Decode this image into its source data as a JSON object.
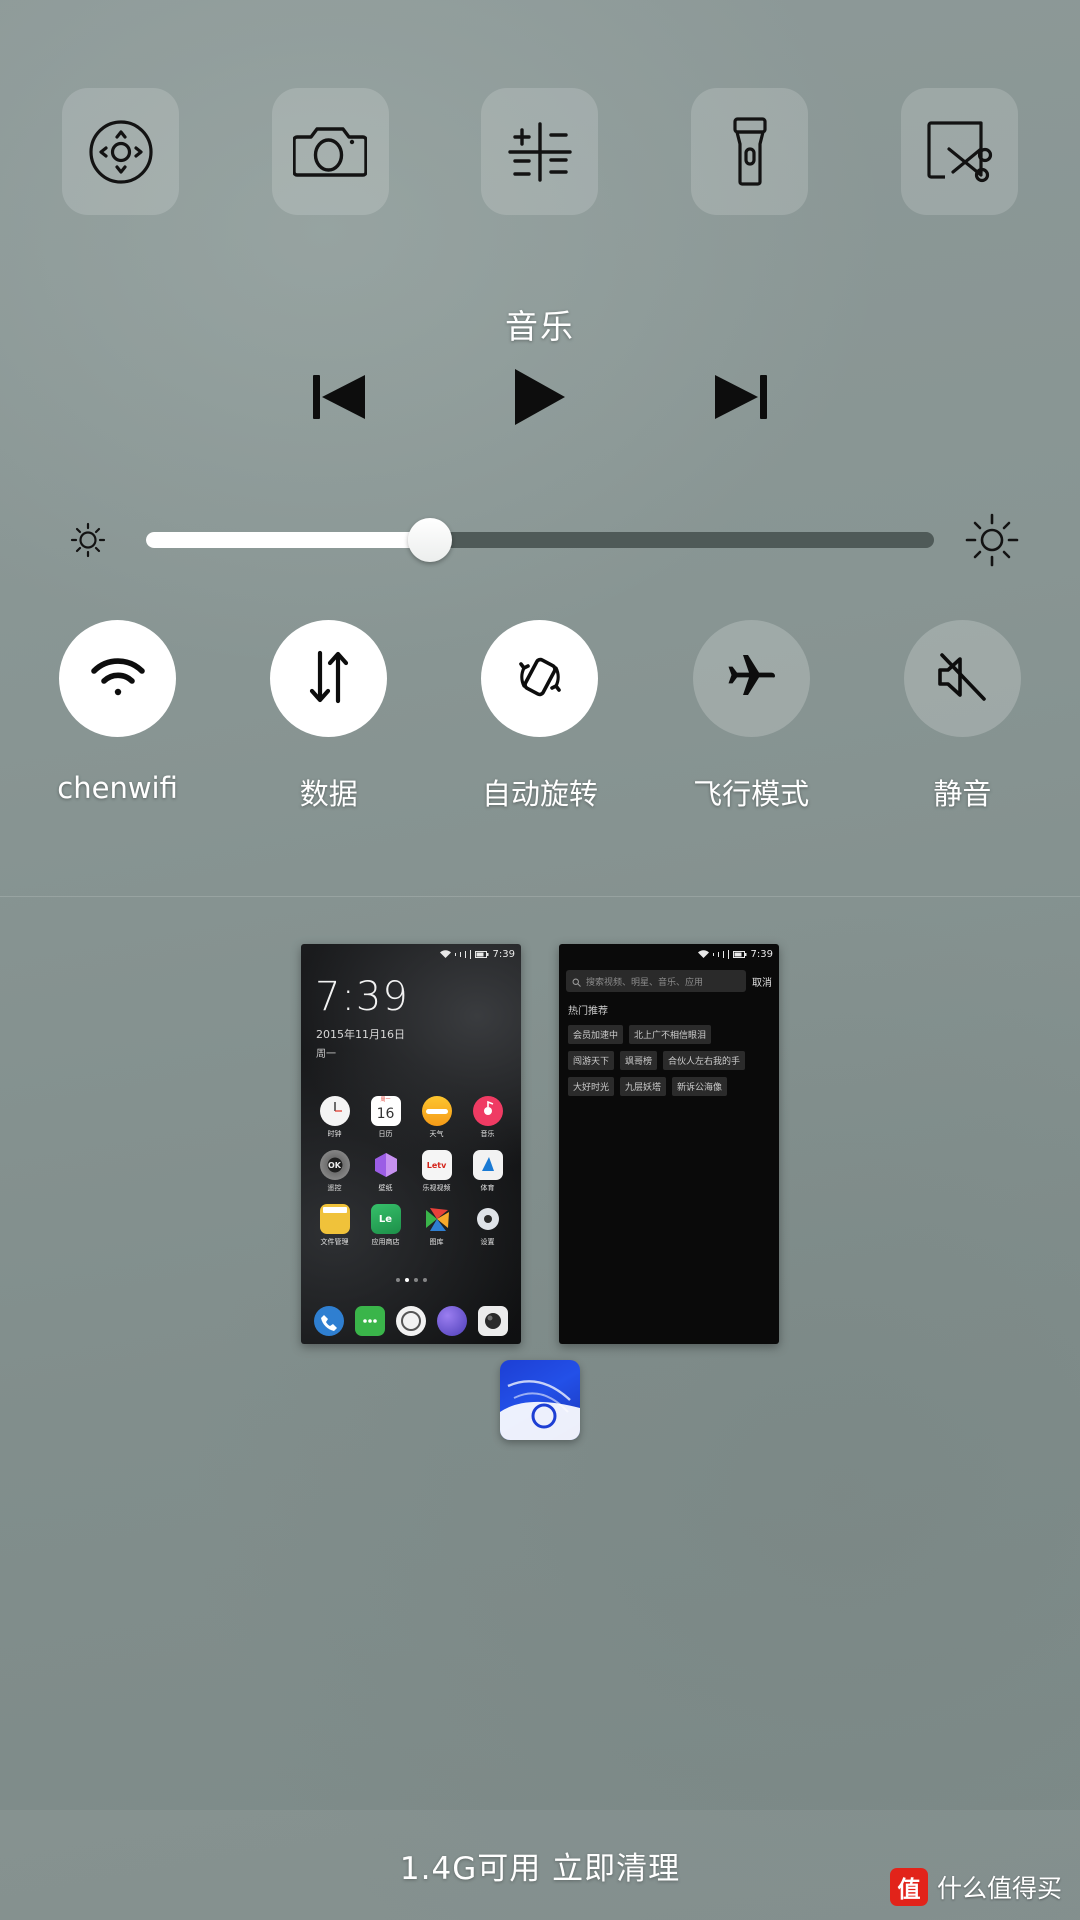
{
  "theme": {
    "background": "#8a9694",
    "accent_white": "#ffffff",
    "track_inactive": "#4f5a58",
    "watermark_red": "#e2231a"
  },
  "shortcuts": [
    {
      "name": "dpad-icon",
      "label": "方向键"
    },
    {
      "name": "camera-icon",
      "label": "相机"
    },
    {
      "name": "calculator-icon",
      "label": "计算器"
    },
    {
      "name": "flashlight-icon",
      "label": "手电筒"
    },
    {
      "name": "screenshot-scissors-icon",
      "label": "截屏"
    }
  ],
  "music": {
    "title": "音乐",
    "controls": [
      {
        "name": "previous-track-button",
        "label": "上一首"
      },
      {
        "name": "play-button",
        "label": "播放"
      },
      {
        "name": "next-track-button",
        "label": "下一首"
      }
    ]
  },
  "brightness": {
    "value_percent": 36,
    "min_icon": "brightness-low-icon",
    "max_icon": "brightness-high-icon"
  },
  "toggles": [
    {
      "label": "chenwifi",
      "icon": "wifi-icon",
      "active": true
    },
    {
      "label": "数据",
      "icon": "mobile-data-icon",
      "active": true
    },
    {
      "label": "自动旋转",
      "icon": "auto-rotate-icon",
      "active": true
    },
    {
      "label": "飞行模式",
      "icon": "airplane-icon",
      "active": false
    },
    {
      "label": "静音",
      "icon": "mute-icon",
      "active": false
    }
  ],
  "recents": {
    "home_thumb": {
      "status_time": "7:39",
      "clock": "7:39",
      "date": "2015年11月16日",
      "weekday": "周一",
      "apps": [
        {
          "name": "时钟",
          "icon": "clock-app-icon"
        },
        {
          "name": "日历",
          "icon": "calendar-app-icon",
          "badge": "16",
          "badge_top": "周一"
        },
        {
          "name": "天气",
          "icon": "weather-app-icon"
        },
        {
          "name": "音乐",
          "icon": "music-app-icon"
        },
        {
          "name": "遥控",
          "icon": "remote-app-icon",
          "glyph": "OK"
        },
        {
          "name": "壁纸",
          "icon": "wallpaper-app-icon"
        },
        {
          "name": "乐视视频",
          "icon": "letv-app-icon",
          "glyph": "Letv"
        },
        {
          "name": "体育",
          "icon": "sports-app-icon"
        },
        {
          "name": "文件管理",
          "icon": "file-manager-app-icon"
        },
        {
          "name": "应用商店",
          "icon": "app-store-app-icon",
          "glyph": "Le"
        },
        {
          "name": "图库",
          "icon": "gallery-app-icon"
        },
        {
          "name": "设置",
          "icon": "settings-app-icon"
        }
      ],
      "page_dots": 4,
      "active_dot": 1,
      "dock": [
        {
          "icon": "phone-dock-icon"
        },
        {
          "icon": "messages-dock-icon"
        },
        {
          "icon": "browser-dock-icon"
        },
        {
          "icon": "globe-dock-icon"
        },
        {
          "icon": "camera-dock-icon"
        }
      ]
    },
    "search_thumb": {
      "status_time": "7:39",
      "search_placeholder": "搜索视频、明星、音乐、应用",
      "cancel_label": "取消",
      "section_title": "热门推荐",
      "tags": [
        [
          "会员加速中",
          "北上广不相信眼泪"
        ],
        [
          "闯游天下",
          "飒哥榜",
          "合伙人左右我的手"
        ],
        [
          "大好时光",
          "九层妖塔",
          "新诉公海像"
        ]
      ]
    },
    "single_app": {
      "icon": "letv-blue-app-icon",
      "label": ""
    }
  },
  "bottom": {
    "memory_text": "1.4G可用 立即清理"
  },
  "watermark": {
    "badge": "值",
    "text": "什么值得买"
  }
}
